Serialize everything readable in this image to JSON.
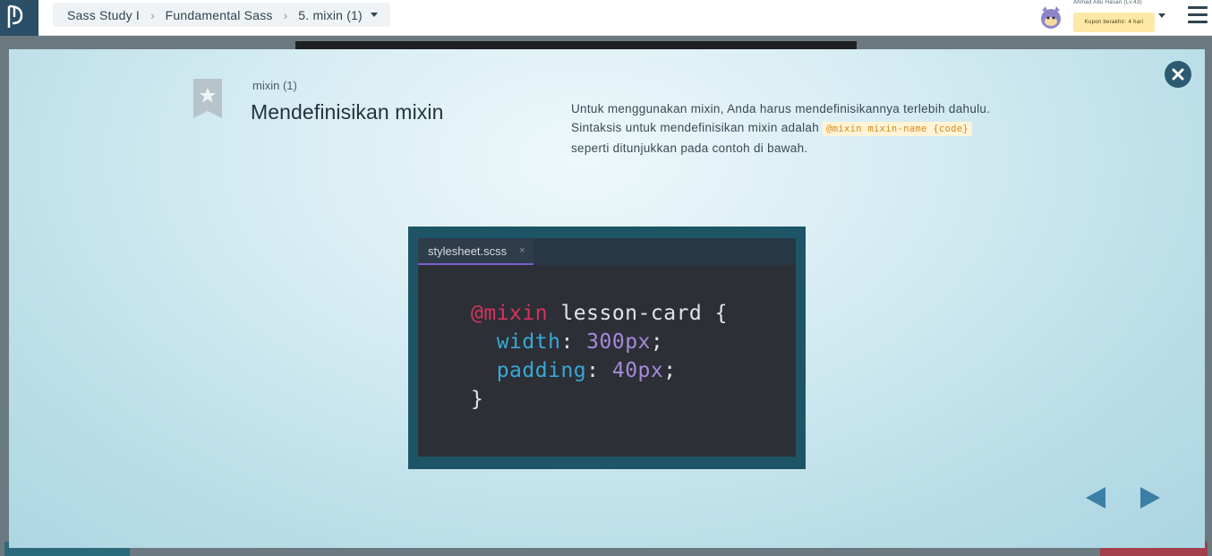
{
  "breadcrumb": {
    "course": "Sass Study I",
    "section": "Fundamental Sass",
    "lesson": "5. mixin (1)"
  },
  "user": {
    "name": "Ahmad Abu Hasan (Lv.43)",
    "coupon": "Kupon berakhir: 4 hari"
  },
  "slide": {
    "subtitle": "mixin (1)",
    "title": "Mendefinisikan mixin",
    "description_part1": "Untuk menggunakan mixin, Anda harus mendefinisikannya terlebih dahulu. Sintaksis untuk mendefinisikan mixin adalah ",
    "code_snippet": "@mixin mixin-name {code}",
    "description_part2": " seperti ditunjukkan pada contoh di bawah."
  },
  "editor": {
    "tab_name": "stylesheet.scss",
    "tab_close": "×",
    "line1_keyword": "@mixin",
    "line1_rest": " lesson-card {",
    "line2_prop": "width",
    "line2_colon": ": ",
    "line2_value": "300px",
    "line2_end": ";",
    "line3_prop": "padding",
    "line3_colon": ": ",
    "line3_value": "40px",
    "line3_end": ";",
    "line4": "}"
  },
  "icons": {
    "logo": "progate-logo-icon",
    "close": "close-circle-icon",
    "prev": "triangle-left-icon",
    "next": "triangle-right-icon",
    "bookmark": "bookmark-star-icon",
    "menu": "hamburger-icon"
  },
  "colors": {
    "accent": "#2c5a70",
    "keyword": "#d8335f",
    "property": "#39a8d5",
    "number": "#a58ad9"
  }
}
